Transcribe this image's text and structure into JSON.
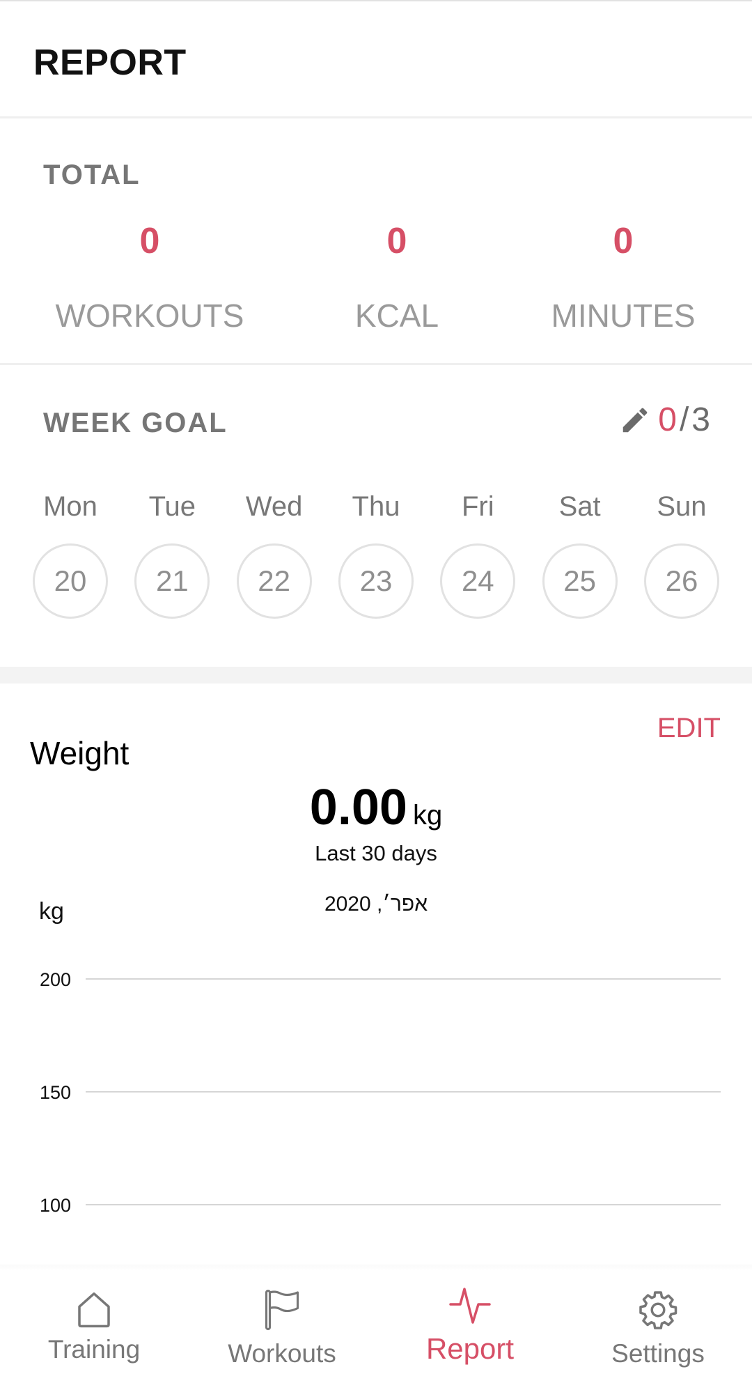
{
  "header": {
    "title": "REPORT"
  },
  "total": {
    "label": "TOTAL",
    "stats": [
      {
        "value": "0",
        "label": "WORKOUTS"
      },
      {
        "value": "0",
        "label": "KCAL"
      },
      {
        "value": "0",
        "label": "MINUTES"
      }
    ]
  },
  "week_goal": {
    "label": "WEEK GOAL",
    "done": "0",
    "separator": "/",
    "target": "3",
    "days": [
      {
        "name": "Mon",
        "date": "20"
      },
      {
        "name": "Tue",
        "date": "21"
      },
      {
        "name": "Wed",
        "date": "22"
      },
      {
        "name": "Thu",
        "date": "23"
      },
      {
        "name": "Fri",
        "date": "24"
      },
      {
        "name": "Sat",
        "date": "25"
      },
      {
        "name": "Sun",
        "date": "26"
      }
    ]
  },
  "weight": {
    "title": "Weight",
    "edit_label": "EDIT",
    "value": "0.00",
    "unit": "kg",
    "period": "Last 30 days"
  },
  "chart_data": {
    "type": "line",
    "title": "",
    "xlabel": "אפר׳, 2020",
    "ylabel": "kg",
    "y_ticks": [
      200,
      150,
      100
    ],
    "ylim": [
      100,
      200
    ],
    "grid": true,
    "series": []
  },
  "tabbar": {
    "items": [
      {
        "label": "Training",
        "icon": "home-icon",
        "active": false
      },
      {
        "label": "Workouts",
        "icon": "flag-icon",
        "active": false
      },
      {
        "label": "Report",
        "icon": "pulse-icon",
        "active": true
      },
      {
        "label": "Settings",
        "icon": "gear-icon",
        "active": false
      }
    ]
  },
  "colors": {
    "accent": "#d64f66",
    "muted_text": "#9a9a9a",
    "section_label": "#767676",
    "circle_border": "#e2e2e2",
    "gridline": "#c8c8c8"
  }
}
